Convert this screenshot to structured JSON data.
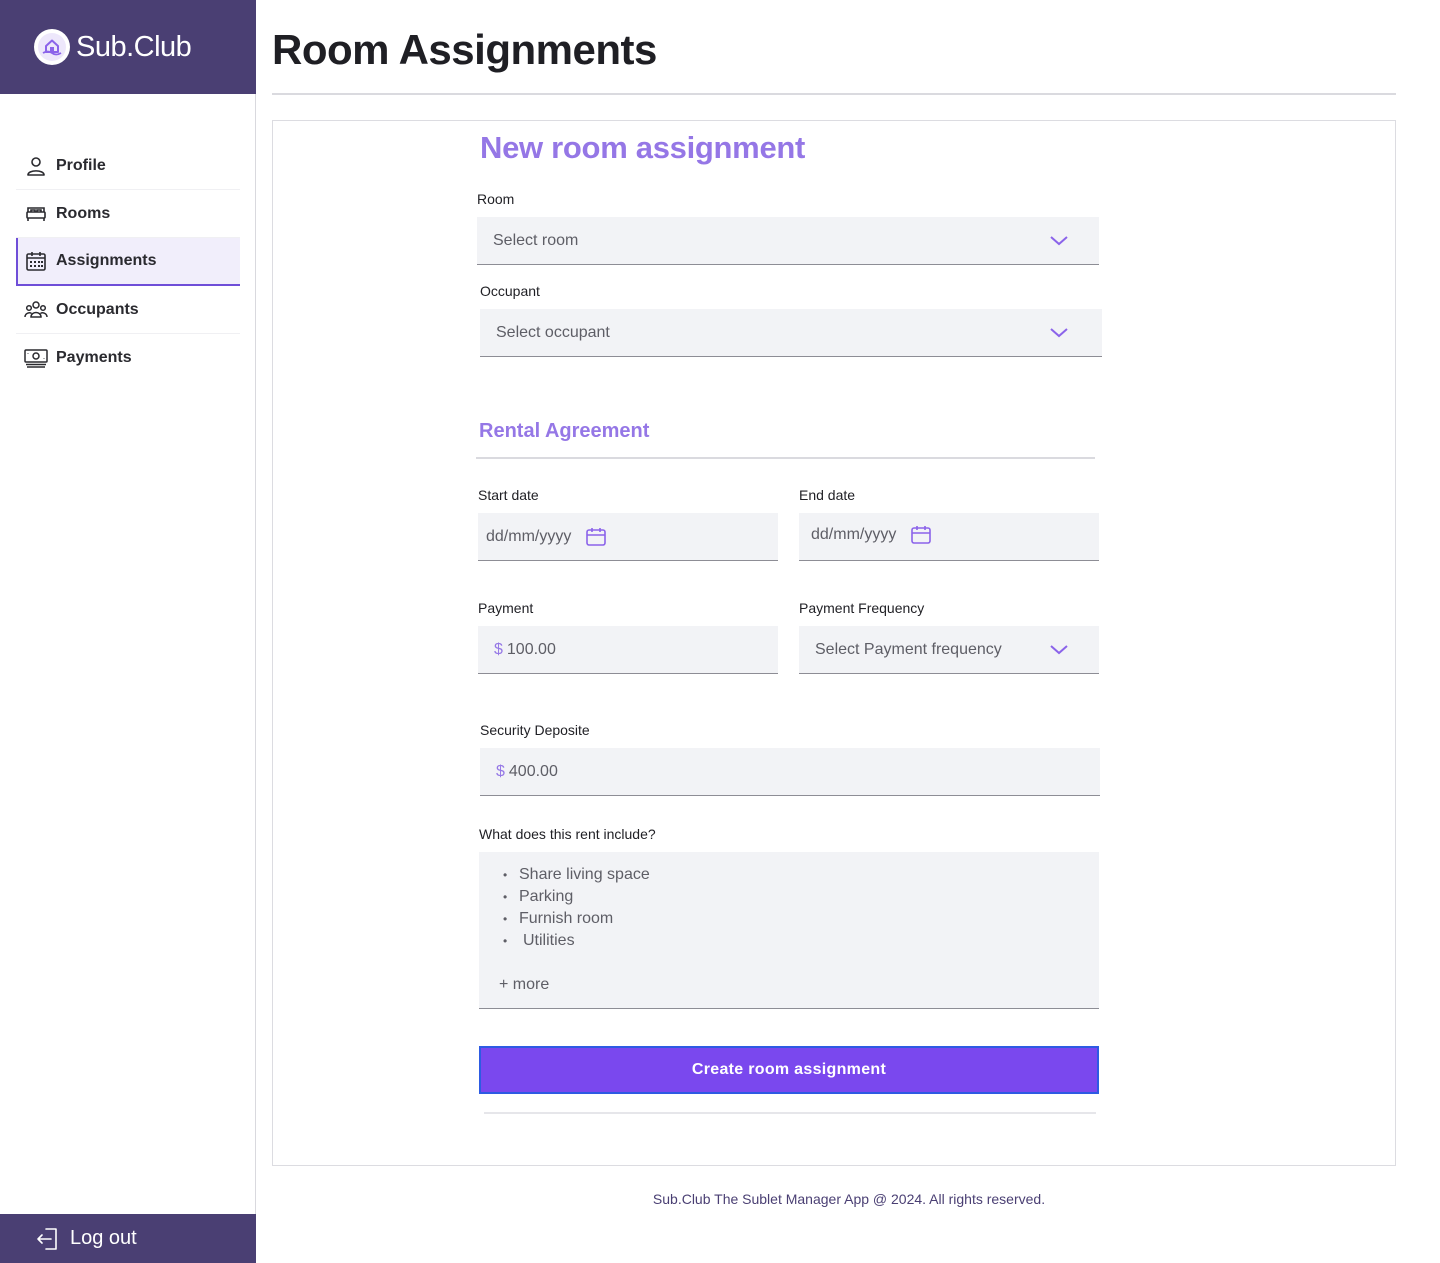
{
  "brand": {
    "name": "Sub.Club"
  },
  "sidebar": {
    "items": [
      {
        "label": "Profile",
        "icon": "user-icon",
        "active": false
      },
      {
        "label": "Rooms",
        "icon": "bed-icon",
        "active": false
      },
      {
        "label": "Assignments",
        "icon": "calendar-icon",
        "active": true
      },
      {
        "label": "Occupants",
        "icon": "users-icon",
        "active": false
      },
      {
        "label": "Payments",
        "icon": "cash-icon",
        "active": false
      }
    ],
    "logout_label": "Log out"
  },
  "page": {
    "title": "Room Assignments"
  },
  "form": {
    "title": "New room assignment",
    "room": {
      "label": "Room",
      "placeholder": "Select room"
    },
    "occupant": {
      "label": "Occupant",
      "placeholder": "Select occupant"
    },
    "rental_section_title": "Rental Agreement",
    "start_date": {
      "label": "Start date",
      "placeholder": "dd/mm/yyyy"
    },
    "end_date": {
      "label": "End date",
      "placeholder": "dd/mm/yyyy"
    },
    "payment": {
      "label": "Payment",
      "currency": "$",
      "value": "100.00"
    },
    "payment_frequency": {
      "label": "Payment Frequency",
      "placeholder": "Select Payment frequency"
    },
    "security_deposit": {
      "label": "Security Deposite",
      "currency": "$",
      "value": "400.00"
    },
    "includes": {
      "label": "What does this rent include?",
      "items": [
        "Share living space",
        "Parking",
        "Furnish room",
        "Utilities"
      ],
      "more_label": "+ more"
    },
    "submit_label": "Create room assignment"
  },
  "footer": {
    "text": "Sub.Club The Sublet Manager App @ 2024. All rights reserved."
  },
  "colors": {
    "brand": "#4a3f73",
    "accent": "#9577e6",
    "button": "#7a48ee"
  }
}
